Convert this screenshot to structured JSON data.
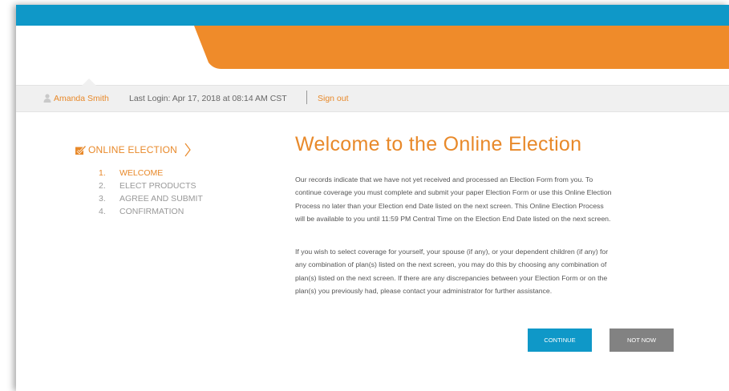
{
  "colors": {
    "brand_blue": "#0f98c8",
    "brand_orange": "#ef8b2a",
    "accent_text": "#e8892a",
    "muted_text": "#999999",
    "button_secondary": "#828282"
  },
  "header": {
    "user_name": "Amanda Smith",
    "last_login": "Last Login: Apr 17, 2018 at 08:14 AM CST",
    "sign_out_label": "Sign out",
    "user_icon": "person-icon"
  },
  "sidebar": {
    "title": "ONLINE ELECTION",
    "title_icon": "checkbox-icon",
    "title_arrow": "chevron-right-icon",
    "steps": [
      {
        "number": "1.",
        "label": "WELCOME",
        "active": true
      },
      {
        "number": "2.",
        "label": "ELECT PRODUCTS",
        "active": false
      },
      {
        "number": "3.",
        "label": "AGREE AND SUBMIT",
        "active": false
      },
      {
        "number": "4.",
        "label": "CONFIRMATION",
        "active": false
      }
    ]
  },
  "main": {
    "heading": "Welcome to the Online Election",
    "paragraph1_lines": [
      "Our records indicate that we have not yet received and processed an Election Form from you. To",
      "continue coverage you must complete and submit your paper Election Form or use this Online Election",
      "Process no later than your Election end Date listed on the next screen. This Online Election Process",
      "will be available to you until 11:59 PM Central Time on the Election End Date listed on the next screen."
    ],
    "paragraph2_lines": [
      "If you wish to select coverage for yourself, your spouse (if any), or your dependent children (if any) for",
      "any combination of plan(s) listed on the next screen, you may do this by choosing any combination of",
      "plan(s) listed on the next screen. If there are any discrepancies between your Election Form or on the",
      "plan(s) you previously had, please contact your administrator for further assistance."
    ]
  },
  "actions": {
    "continue_label": "CONTINUE",
    "not_now_label": "NOT NOW"
  }
}
